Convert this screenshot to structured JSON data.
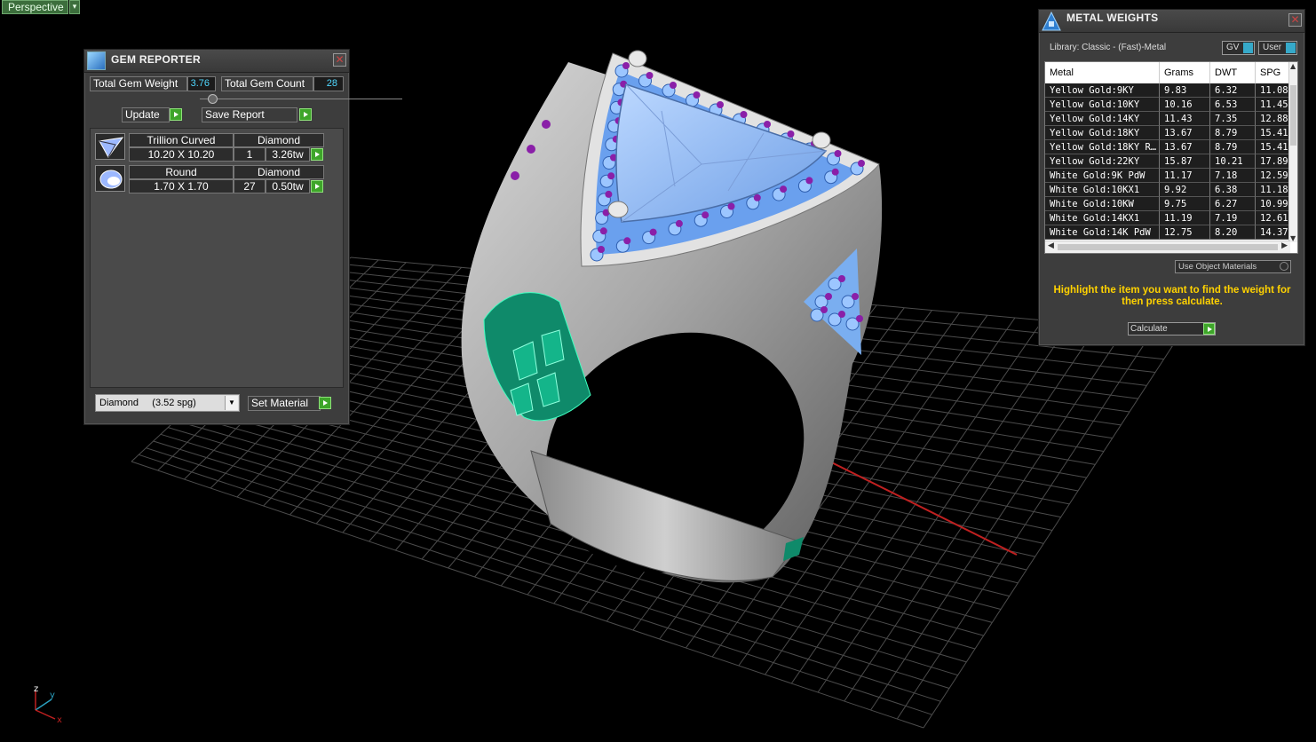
{
  "viewport": {
    "label": "Perspective",
    "dropdown_arrow": "▾",
    "axes": {
      "z": "z",
      "y": "y",
      "x": "x"
    }
  },
  "gem_reporter": {
    "title": "GEM REPORTER",
    "icon": "gem-reporter-icon",
    "close": "✕",
    "total_weight_label": "Total Gem Weight",
    "total_weight_value": "3.76",
    "total_count_label": "Total Gem Count",
    "total_count_value": "28",
    "slider_position": 0.06,
    "update_label": "Update",
    "save_report_label": "Save Report",
    "gems": [
      {
        "shape": "Trillion Curved",
        "material": "Diamond",
        "size": "10.20 X 10.20",
        "count": "1",
        "weight": "3.26tw",
        "thumb": "trillion-gem-icon"
      },
      {
        "shape": "Round",
        "material": "Diamond",
        "size": "1.70 X 1.70",
        "count": "27",
        "weight": "0.50tw",
        "thumb": "round-gem-icon"
      }
    ],
    "material_select": "Diamond     (3.52 spg)",
    "set_material_label": "Set Material"
  },
  "metal_weights": {
    "title": "METAL WEIGHTS",
    "icon": "metal-weights-icon",
    "close": "✕",
    "library": "Library: Classic - (Fast)-Metal",
    "toggle_gv": "GV",
    "toggle_user": "User",
    "columns": [
      "Metal",
      "Grams",
      "DWT",
      "SPG"
    ],
    "rows": [
      [
        "Yellow Gold:9KY",
        "9.83",
        "6.32",
        "11.08"
      ],
      [
        "Yellow Gold:10KY",
        "10.16",
        "6.53",
        "11.45"
      ],
      [
        "Yellow Gold:14KY",
        "11.43",
        "7.35",
        "12.88"
      ],
      [
        "Yellow Gold:18KY",
        "13.67",
        "8.79",
        "15.41"
      ],
      [
        "Yellow Gold:18KY R…",
        "13.67",
        "8.79",
        "15.41"
      ],
      [
        "Yellow Gold:22KY",
        "15.87",
        "10.21",
        "17.89"
      ],
      [
        "White Gold:9K PdW",
        "11.17",
        "7.18",
        "12.59"
      ],
      [
        "White Gold:10KX1",
        "9.92",
        "6.38",
        "11.18"
      ],
      [
        "White Gold:10KW",
        "9.75",
        "6.27",
        "10.99"
      ],
      [
        "White Gold:14KX1",
        "11.19",
        "7.19",
        "12.61"
      ],
      [
        "White Gold:14K PdW",
        "12.75",
        "8.20",
        "14.37"
      ]
    ],
    "use_object_materials": "Use Object Materials",
    "hint": "Highlight the item you want to find the weight for then press calculate.",
    "calculate_label": "Calculate",
    "colors": {
      "hint": "#ffd200",
      "accent": "#36a9c9",
      "go": "#3ea52a"
    }
  }
}
